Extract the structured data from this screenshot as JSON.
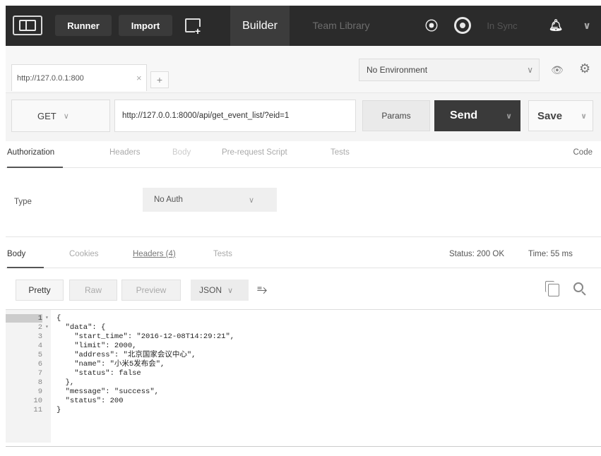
{
  "toolbar": {
    "runner_label": "Runner",
    "import_label": "Import",
    "builder_label": "Builder",
    "team_library_label": "Team Library",
    "sync_status_label": "In Sync",
    "icons": [
      "sidebar-toggle-icon",
      "new-window-icon",
      "interceptor-icon",
      "profile-icon",
      "bell-icon",
      "chevron-down-icon"
    ]
  },
  "tabs": {
    "items": [
      {
        "label": "http://127.0.0.1:800",
        "close": "×"
      }
    ],
    "add_label": "+",
    "environment": {
      "selected": "No Environment",
      "chevron": "∨"
    }
  },
  "request": {
    "method": "GET",
    "method_chevron": "∨",
    "url": "http://127.0.0.1:8000/api/get_event_list/?eid=1",
    "params_label": "Params",
    "send_label": "Send",
    "save_label": "Save",
    "chevron": "∨"
  },
  "request_tabs": {
    "items": [
      "Authorization",
      "Headers",
      "Body",
      "Pre-request Script",
      "Tests"
    ],
    "active": "Authorization",
    "code_label": "Code"
  },
  "auth": {
    "type_label": "Type",
    "selected": "No Auth",
    "chevron": "∨"
  },
  "response_tabs": {
    "items": [
      "Body",
      "Cookies",
      "Headers (4)",
      "Tests"
    ],
    "active": "Body",
    "status_label": "Status: 200 OK",
    "time_label": "Time: 55 ms"
  },
  "response_toolbar": {
    "views": [
      "Pretty",
      "Raw",
      "Preview"
    ],
    "active_view": "Pretty",
    "format": "JSON",
    "chevron": "∨",
    "wrap_glyph": "⥱"
  },
  "response_body": {
    "lines": [
      {
        "n": "1",
        "fold": "▾",
        "text": "{"
      },
      {
        "n": "2",
        "fold": "▾",
        "text": "  \"data\": {"
      },
      {
        "n": "3",
        "fold": "",
        "text": "    \"start_time\": \"2016-12-08T14:29:21\","
      },
      {
        "n": "4",
        "fold": "",
        "text": "    \"limit\": 2000,"
      },
      {
        "n": "5",
        "fold": "",
        "text": "    \"address\": \"北京国家会议中心\","
      },
      {
        "n": "6",
        "fold": "",
        "text": "    \"name\": \"小米5发布会\","
      },
      {
        "n": "7",
        "fold": "",
        "text": "    \"status\": false"
      },
      {
        "n": "8",
        "fold": "",
        "text": "  },"
      },
      {
        "n": "9",
        "fold": "",
        "text": "  \"message\": \"success\","
      },
      {
        "n": "10",
        "fold": "",
        "text": "  \"status\": 200"
      },
      {
        "n": "11",
        "fold": "",
        "text": "}"
      }
    ]
  }
}
